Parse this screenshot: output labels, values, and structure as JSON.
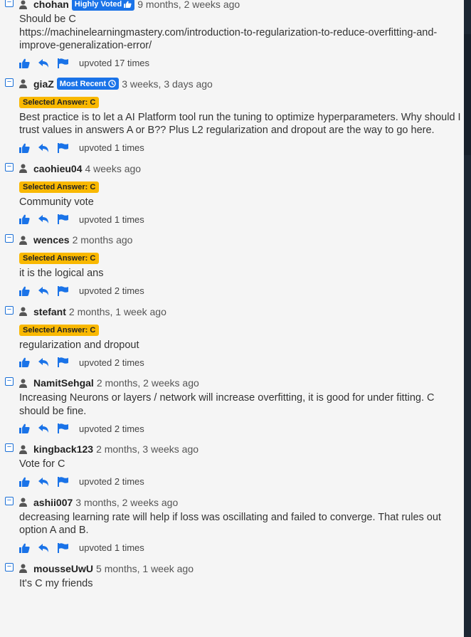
{
  "comments": [
    {
      "user": "chohan",
      "badge": "Highly Voted",
      "badge_icon": "thumbs-up-icon",
      "ago": "9 months, 2 weeks ago",
      "selected": "",
      "text": "Should be C\nhttps://machinelearningmastery.com/introduction-to-regularization-to-reduce-overfitting-and-improve-generalization-error/",
      "upvoted": "upvoted 17 times"
    },
    {
      "user": "giaZ",
      "badge": "Most Recent",
      "badge_icon": "clock-icon",
      "ago": "3 weeks, 3 days ago",
      "selected": "Selected Answer: C",
      "text": "Best practice is to let a AI Platform tool run the tuning to optimize hyperparameters. Why should I trust values in answers A or B?? Plus L2 regularization and dropout are the way to go here.",
      "upvoted": "upvoted 1 times"
    },
    {
      "user": "caohieu04",
      "badge": "",
      "ago": "4 weeks ago",
      "selected": "Selected Answer: C",
      "text": "Community vote",
      "upvoted": "upvoted 1 times"
    },
    {
      "user": "wences",
      "badge": "",
      "ago": "2 months ago",
      "selected": "Selected Answer: C",
      "text": "it is the logical ans",
      "upvoted": "upvoted 2 times"
    },
    {
      "user": "stefant",
      "badge": "",
      "ago": "2 months, 1 week ago",
      "selected": "Selected Answer: C",
      "text": "regularization and dropout",
      "upvoted": "upvoted 2 times"
    },
    {
      "user": "NamitSehgal",
      "badge": "",
      "ago": "2 months, 2 weeks ago",
      "selected": "",
      "text": "Increasing Neurons or layers / network will increase overfitting, it is good for under fitting. C should be fine.",
      "upvoted": "upvoted 2 times"
    },
    {
      "user": "kingback123",
      "badge": "",
      "ago": "2 months, 3 weeks ago",
      "selected": "",
      "text": "Vote for C",
      "upvoted": "upvoted 2 times"
    },
    {
      "user": "ashii007",
      "badge": "",
      "ago": "3 months, 2 weeks ago",
      "selected": "",
      "text": "decreasing learning rate will help if loss was oscillating and failed to converge. That rules out option A and B.",
      "upvoted": "upvoted 1 times"
    },
    {
      "user": "mousseUwU",
      "badge": "",
      "ago": "5 months, 1 week ago",
      "selected": "",
      "text": "It's C my friends",
      "upvoted": ""
    }
  ],
  "colors": {
    "accent": "#1a73e8",
    "selected_badge": "#f9b800"
  },
  "icons": {
    "toggle": "collapse-minus-icon",
    "user": "user-icon",
    "upvote": "thumbs-up-icon",
    "reply": "reply-icon",
    "report": "flag-icon"
  }
}
